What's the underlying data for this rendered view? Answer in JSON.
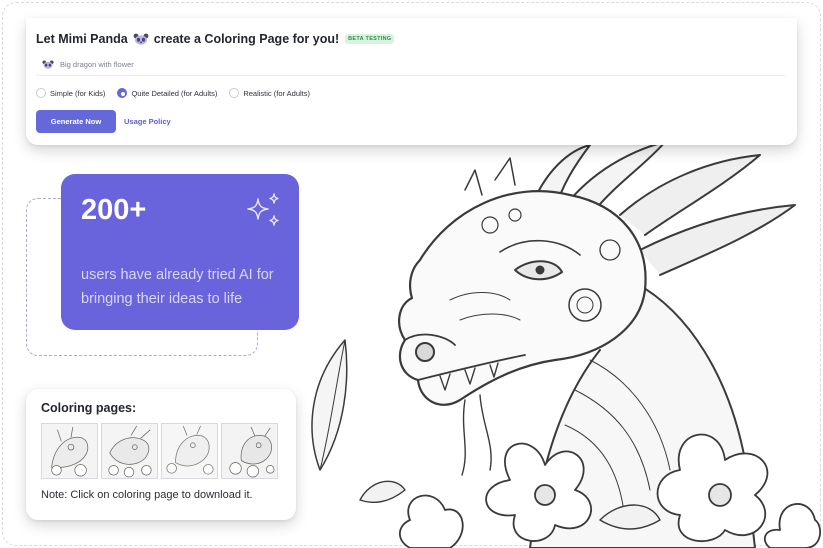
{
  "generator": {
    "title": "Let Mimi Panda",
    "title_suffix": "create a Coloring Page for you!",
    "beta_badge": "BETA TESTING",
    "prompt_placeholder": "Big dragon with flower",
    "options": [
      {
        "label": "Simple (for Kids)",
        "checked": false
      },
      {
        "label": "Quite Detailed (for Adults)",
        "checked": true
      },
      {
        "label": "Realistic (for Adults)",
        "checked": false
      }
    ],
    "generate_label": "Generate Now",
    "usage_label": "Usage Policy"
  },
  "stats": {
    "number": "200+",
    "description": "users have already tried AI for bringing their ideas to life"
  },
  "pages": {
    "title": "Coloring pages:",
    "thumbnails": [
      "dragon-page-1",
      "dragon-page-2",
      "dragon-page-3",
      "dragon-page-4"
    ],
    "note": "Note: Click on coloring page to download it."
  },
  "colors": {
    "accent": "#6468d8",
    "stats_bg": "#6a64dc",
    "beta_bg": "#d7f3df",
    "beta_text": "#2f8a4e"
  },
  "icons": [
    "panda-icon",
    "sparkle-icon"
  ]
}
